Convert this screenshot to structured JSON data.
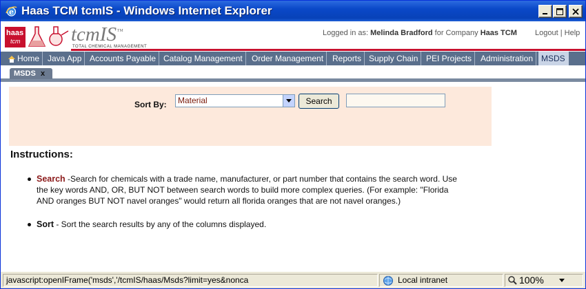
{
  "window": {
    "title": "Haas TCM tcmIS - Windows Internet Explorer",
    "buttons": [
      "minimize",
      "maximize",
      "close"
    ]
  },
  "header": {
    "logo_top": "haas",
    "logo_bottom": "tcm",
    "brand": "tcmIS",
    "brand_tm": "™",
    "brand_sub": "TOTAL CHEMICAL MANAGEMENT",
    "logged_in_prefix": "Logged in as:",
    "user_name": "Melinda Bradford",
    "company_prefix": "for Company",
    "company_name": "Haas TCM",
    "logout_label": "Logout",
    "separator": "|",
    "help_label": "Help"
  },
  "nav": {
    "items": [
      {
        "label": "Home"
      },
      {
        "label": "Java App"
      },
      {
        "label": "Accounts Payable"
      },
      {
        "label": "Catalog Management"
      },
      {
        "label": "Order Management"
      },
      {
        "label": "Reports"
      },
      {
        "label": "Supply Chain"
      },
      {
        "label": "PEI Projects"
      },
      {
        "label": "Administration"
      },
      {
        "label": "MSDS"
      }
    ]
  },
  "tabs": [
    {
      "label": "MSDS",
      "close": "x"
    }
  ],
  "search": {
    "sort_label": "Sort By:",
    "sort_value": "Material",
    "button_label": "Search",
    "input_value": ""
  },
  "instructions": {
    "title": "Instructions:",
    "items": [
      {
        "term": "Search",
        "line1": " -Search for chemicals with a trade name, manufacturer, or part number that contains the search word. Use",
        "line2": "the key words AND, OR, BUT NOT between search words to build more complex queries. (For example: \"Florida",
        "line3": "AND oranges BUT NOT navel oranges\" would return all florida oranges that are not navel oranges.)"
      },
      {
        "term": "Sort",
        "line1": " - Sort the search results by any of the columns displayed."
      }
    ]
  },
  "statusbar": {
    "url": "javascript:openIFrame('msds','/tcmIS/haas/Msds?limit=yes&nonca",
    "zone": "Local intranet",
    "zoom": "100%"
  },
  "colors": {
    "title_bar": "#0a48c8",
    "brand_red": "#c8102e",
    "nav_bg": "#5a6f8c",
    "nav_active_bg": "#c9d4e6",
    "search_panel_bg": "#fde9dc",
    "search_term": "#8b1a1a"
  }
}
